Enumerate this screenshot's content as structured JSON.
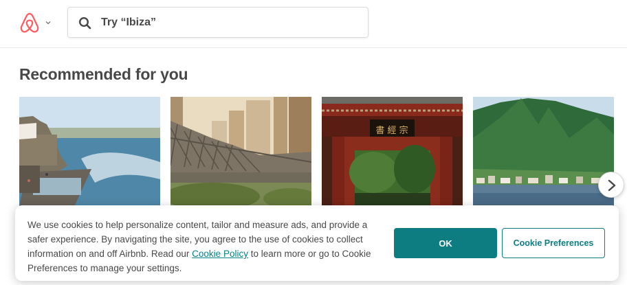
{
  "header": {
    "logo_icon": "airbnb-logo-icon",
    "menu_caret_icon": "chevron-down-icon",
    "search": {
      "icon": "search-icon",
      "placeholder": "Try “Ibiza”"
    }
  },
  "main": {
    "section_title": "Recommended for you",
    "cards": [
      {
        "image": "coastal-rock-pool-photo"
      },
      {
        "image": "bridge-city-skyline-photo"
      },
      {
        "image": "chinese-gate-garden-photo"
      },
      {
        "image": "mountain-lakeside-town-photo"
      }
    ],
    "next_icon": "chevron-right-icon"
  },
  "cookie_banner": {
    "text_before_link": "We use cookies to help personalize content, tailor and measure ads, and provide a safer experience. By navigating the site, you agree to the use of cookies to collect information on and off Airbnb. Read our ",
    "link_label": "Cookie Policy",
    "text_after_link": " to learn more or go to Cookie Preferences to manage your settings.",
    "ok_label": "OK",
    "preferences_label": "Cookie Preferences"
  },
  "colors": {
    "brand": "#ff5a5f",
    "accent": "#0e7d82",
    "link": "#008489",
    "text": "#484848"
  }
}
